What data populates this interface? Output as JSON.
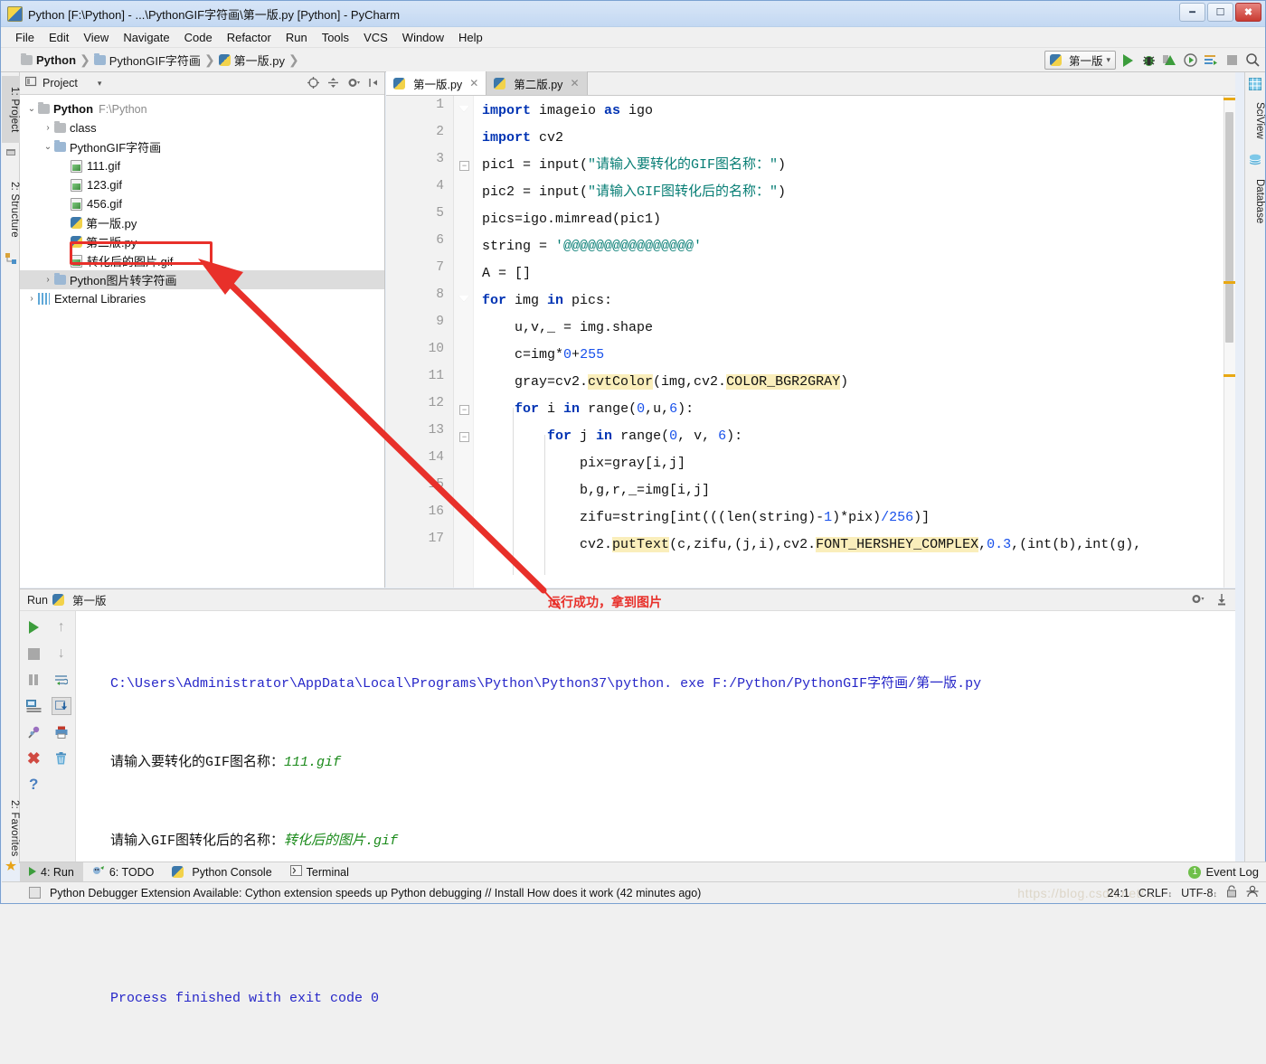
{
  "window": {
    "title": "Python [F:\\Python] - ...\\PythonGIF字符画\\第一版.py [Python] - PyCharm",
    "minimize": "🗕",
    "maximize": "🗖",
    "close": "✕"
  },
  "menubar": {
    "items": [
      "File",
      "Edit",
      "View",
      "Navigate",
      "Code",
      "Refactor",
      "Run",
      "Tools",
      "VCS",
      "Window",
      "Help"
    ]
  },
  "breadcrumb": {
    "items": [
      "Python",
      "PythonGIF字符画",
      "第一版.py"
    ],
    "separator": "❯"
  },
  "toolbar": {
    "run_config": "第一版",
    "run_config_caret": "⌄",
    "icons": [
      "run-icon",
      "debug-icon",
      "coverage-icon",
      "profile-icon",
      "run-with-console-icon",
      "stop-icon",
      "search-icon"
    ]
  },
  "left_tabs": [
    {
      "label": "1: Project",
      "selected": true
    },
    {
      "label": "2: Structure",
      "selected": false
    },
    {
      "label": "2: Favorites",
      "selected": false
    }
  ],
  "right_tabs": [
    {
      "label": "SciView"
    },
    {
      "label": "Database"
    }
  ],
  "project_panel": {
    "title": "Project",
    "caret": "▾",
    "header_icons": [
      "locate-icon",
      "collapse-all-icon",
      "settings-icon",
      "hide-icon"
    ],
    "tree": [
      {
        "indent": 0,
        "arrow": "⌄",
        "icon": "folder-icon",
        "label": "Python",
        "bold": true,
        "secondary": "F:\\Python"
      },
      {
        "indent": 1,
        "arrow": "›",
        "icon": "folder-icon",
        "label": "class",
        "bold": false,
        "secondary": ""
      },
      {
        "indent": 1,
        "arrow": "⌄",
        "icon": "source-folder-icon",
        "label": "PythonGIF字符画",
        "bold": false,
        "secondary": ""
      },
      {
        "indent": 2,
        "arrow": "",
        "icon": "gif-file-icon",
        "label": "111.gif",
        "bold": false,
        "secondary": ""
      },
      {
        "indent": 2,
        "arrow": "",
        "icon": "gif-file-icon",
        "label": "123.gif",
        "bold": false,
        "secondary": ""
      },
      {
        "indent": 2,
        "arrow": "",
        "icon": "gif-file-icon",
        "label": "456.gif",
        "bold": false,
        "secondary": ""
      },
      {
        "indent": 2,
        "arrow": "",
        "icon": "python-file-icon",
        "label": "第一版.py",
        "bold": false,
        "secondary": ""
      },
      {
        "indent": 2,
        "arrow": "",
        "icon": "python-file-icon",
        "label": "第二版.py",
        "bold": false,
        "secondary": ""
      },
      {
        "indent": 2,
        "arrow": "",
        "icon": "gif-file-icon",
        "label": "转化后的图片.gif",
        "bold": false,
        "secondary": "",
        "highlighted": true
      },
      {
        "indent": 1,
        "arrow": "›",
        "icon": "source-folder-icon",
        "label": "Python图片转字符画",
        "bold": false,
        "secondary": "",
        "selected": true
      },
      {
        "indent": 0,
        "arrow": "›",
        "icon": "external-libraries-icon",
        "label": "External Libraries",
        "bold": false,
        "secondary": ""
      }
    ]
  },
  "editor": {
    "tabs": [
      {
        "label": "第一版.py",
        "active": true,
        "close": "✕"
      },
      {
        "label": "第二版.py",
        "active": false,
        "close": "✕"
      }
    ],
    "line_numbers": [
      "1",
      "2",
      "3",
      "4",
      "5",
      "6",
      "7",
      "8",
      "9",
      "10",
      "11",
      "12",
      "13",
      "14",
      "15",
      "16",
      "17"
    ],
    "lines": [
      {
        "n": 1,
        "indent": 0,
        "segments": [
          {
            "t": "import ",
            "c": "kw"
          },
          {
            "t": "imageio ",
            "c": ""
          },
          {
            "t": "as ",
            "c": "kw"
          },
          {
            "t": "igo",
            "c": ""
          }
        ]
      },
      {
        "n": 2,
        "indent": 0,
        "segments": [
          {
            "t": "import ",
            "c": "kw"
          },
          {
            "t": "cv2",
            "c": ""
          }
        ]
      },
      {
        "n": 3,
        "indent": 0,
        "segments": [
          {
            "t": "pic1 = input(",
            "c": ""
          },
          {
            "t": "\"请输入要转化的GIF图名称：\"",
            "c": "str"
          },
          {
            "t": ")",
            "c": ""
          }
        ]
      },
      {
        "n": 4,
        "indent": 0,
        "segments": [
          {
            "t": "pic2 = input(",
            "c": ""
          },
          {
            "t": "\"请输入GIF图转化后的名称：\"",
            "c": "str"
          },
          {
            "t": ")",
            "c": ""
          }
        ]
      },
      {
        "n": 5,
        "indent": 0,
        "segments": [
          {
            "t": "pics=igo.mimread(pic1)",
            "c": ""
          }
        ]
      },
      {
        "n": 6,
        "indent": 0,
        "segments": [
          {
            "t": "string = ",
            "c": ""
          },
          {
            "t": "'@@@@@@@@@@@@@@@@'",
            "c": "str"
          }
        ]
      },
      {
        "n": 7,
        "indent": 0,
        "segments": [
          {
            "t": "A = []",
            "c": ""
          }
        ]
      },
      {
        "n": 8,
        "indent": 0,
        "segments": [
          {
            "t": "for ",
            "c": "kw"
          },
          {
            "t": "img ",
            "c": ""
          },
          {
            "t": "in ",
            "c": "kw"
          },
          {
            "t": "pics:",
            "c": ""
          }
        ]
      },
      {
        "n": 9,
        "indent": 1,
        "segments": [
          {
            "t": "u,v,_ = img.shape",
            "c": ""
          }
        ]
      },
      {
        "n": 10,
        "indent": 1,
        "segments": [
          {
            "t": "c=img*",
            "c": ""
          },
          {
            "t": "0",
            "c": "num"
          },
          {
            "t": "+",
            "c": ""
          },
          {
            "t": "255",
            "c": "num"
          }
        ]
      },
      {
        "n": 11,
        "indent": 1,
        "segments": [
          {
            "t": "gray=cv2.",
            "c": ""
          },
          {
            "t": "cvtColor",
            "c": "hlw"
          },
          {
            "t": "(img,cv2.",
            "c": ""
          },
          {
            "t": "COLOR_BGR2GRAY",
            "c": "hlw"
          },
          {
            "t": ")",
            "c": ""
          }
        ]
      },
      {
        "n": 12,
        "indent": 1,
        "segments": [
          {
            "t": "for ",
            "c": "kw"
          },
          {
            "t": "i ",
            "c": ""
          },
          {
            "t": "in ",
            "c": "kw"
          },
          {
            "t": "range(",
            "c": ""
          },
          {
            "t": "0",
            "c": "num"
          },
          {
            "t": ",u,",
            "c": ""
          },
          {
            "t": "6",
            "c": "num"
          },
          {
            "t": "):",
            "c": ""
          }
        ]
      },
      {
        "n": 13,
        "indent": 2,
        "segments": [
          {
            "t": "for ",
            "c": "kw"
          },
          {
            "t": "j ",
            "c": ""
          },
          {
            "t": "in ",
            "c": "kw"
          },
          {
            "t": "range(",
            "c": ""
          },
          {
            "t": "0",
            "c": "num"
          },
          {
            "t": ", v, ",
            "c": ""
          },
          {
            "t": "6",
            "c": "num"
          },
          {
            "t": "):",
            "c": ""
          }
        ]
      },
      {
        "n": 14,
        "indent": 3,
        "segments": [
          {
            "t": "pix=gray[i,j]",
            "c": ""
          }
        ]
      },
      {
        "n": 15,
        "indent": 3,
        "segments": [
          {
            "t": "b,g,r,_=img[i,j]",
            "c": ""
          }
        ]
      },
      {
        "n": 16,
        "indent": 3,
        "segments": [
          {
            "t": "zifu=string[int(((len(string)-",
            "c": ""
          },
          {
            "t": "1",
            "c": "num"
          },
          {
            "t": ")*pix)",
            "c": ""
          },
          {
            "t": "/256",
            "c": "num"
          },
          {
            "t": ")]",
            "c": ""
          }
        ]
      },
      {
        "n": 17,
        "indent": 3,
        "segments": [
          {
            "t": "cv2.",
            "c": ""
          },
          {
            "t": "putText",
            "c": "hlw"
          },
          {
            "t": "(c,zifu,(j,i),cv2.",
            "c": ""
          },
          {
            "t": "FONT_HERSHEY_COMPLEX",
            "c": "hlw"
          },
          {
            "t": ",",
            "c": ""
          },
          {
            "t": "0.3",
            "c": "num"
          },
          {
            "t": ",(",
            "c": ""
          },
          {
            "t": "int",
            "c": "fn"
          },
          {
            "t": "(b),",
            "c": ""
          },
          {
            "t": "int",
            "c": "fn"
          },
          {
            "t": "(g),",
            "c": ""
          }
        ]
      }
    ]
  },
  "run_panel": {
    "header_label": "Run",
    "config_name": "第一版",
    "header_icons": [
      "settings-icon",
      "export-icon"
    ],
    "tool_icons_left": [
      "rerun-icon",
      "stop-icon",
      "pause-icon",
      "show-console-icon",
      "pin-icon",
      "close-icon",
      "help-icon"
    ],
    "tool_icons_right": [
      "up-icon",
      "down-icon",
      "soft-wrap-icon",
      "scroll-to-end-icon",
      "print-icon",
      "clear-all-icon"
    ],
    "console": [
      {
        "text": "C:\\Users\\Administrator\\AppData\\Local\\Programs\\Python\\Python37\\python. exe F:/Python/PythonGIF字符画/第一版.py",
        "style": "blue"
      },
      {
        "prompt": "请输入要转化的GIF图名称：",
        "value": "111.gif",
        "style": "input"
      },
      {
        "prompt": "请输入GIF图转化后的名称：",
        "value": "转化后的图片.gif",
        "style": "input"
      },
      {
        "text": "",
        "style": "plain"
      },
      {
        "text": "Process finished with exit code 0",
        "style": "blue"
      }
    ]
  },
  "bottom_bar": {
    "items": [
      {
        "label": "4: Run",
        "icon": "run-icon",
        "selected": true
      },
      {
        "label": "6: TODO",
        "icon": "todo-icon",
        "selected": false
      },
      {
        "label": "Python Console",
        "icon": "python-icon",
        "selected": false
      },
      {
        "label": "Terminal",
        "icon": "terminal-icon",
        "selected": false
      }
    ],
    "event_log": {
      "label": "Event Log",
      "badge": "1"
    }
  },
  "status_bar": {
    "message": "Python Debugger Extension Available: Cython extension speeds up Python debugging // Install How does it work (42 minutes ago)",
    "caret_position": "24:1",
    "line_separator": "CRLF",
    "encoding": "UTF-8",
    "lock_icon": "🔒",
    "inspection_icon": "👤",
    "watermark": "https://blog.csdn.net/…"
  },
  "annotations": {
    "note": "运行成功，拿到图片",
    "arrow_color": "#e8302a",
    "highlight_color": "#e8302a"
  }
}
